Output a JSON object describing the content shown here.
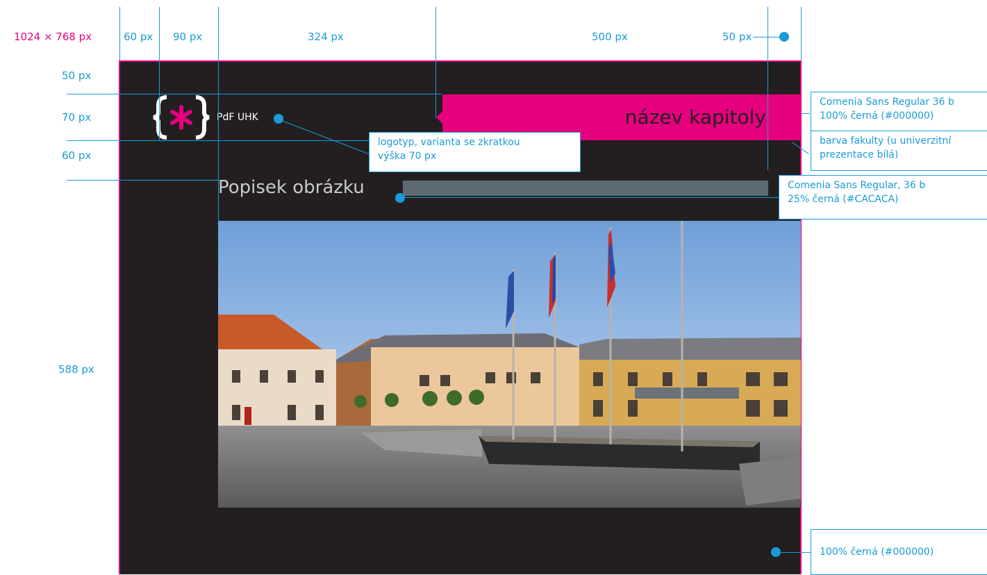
{
  "colors": {
    "accent": "#e5007e",
    "annotation": "#1a9bd7",
    "slide_bg": "#231f20",
    "caption_bar": "#5e6c72",
    "caption_text": "#cacaca"
  },
  "dimensions": {
    "canvas": "1024 × 768 px",
    "cols": [
      "60 px",
      "90 px",
      "324 px",
      "500 px",
      "50 px"
    ],
    "rows": [
      "50 px",
      "70 px",
      "60 px",
      "588 px"
    ]
  },
  "slide": {
    "logo_abbrev": "PdF UHK",
    "chapter_title": "název kapitoly",
    "caption": "Popisek obrázku"
  },
  "callouts": {
    "logo": [
      "logotyp, varianta se zkratkou",
      "výška 70 px"
    ],
    "chapter_font": [
      "Comenia Sans Regular 36 b",
      "100% černá (#000000)"
    ],
    "faculty_color": [
      "barva fakulty (u univerzitní",
      "prezentace bílá)"
    ],
    "caption_font": [
      "Comenia Sans Regular, 36 b",
      "25% černá (#CACACA)"
    ],
    "background": "100% černá (#000000)"
  }
}
